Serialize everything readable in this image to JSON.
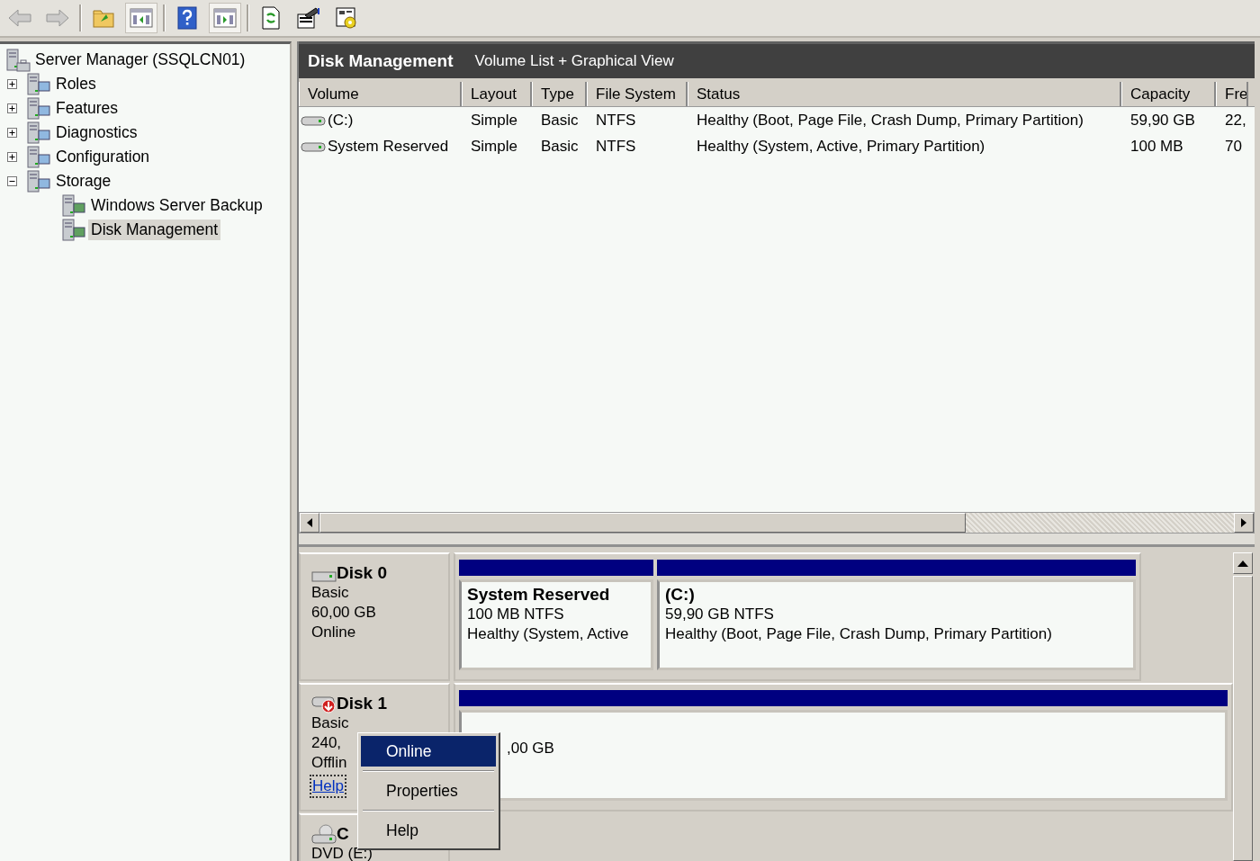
{
  "toolbar": [
    {
      "kind": "back",
      "disabled": true,
      "pressed": false
    },
    {
      "kind": "forward",
      "disabled": true,
      "pressed": false
    },
    {
      "kind": "up",
      "disabled": false,
      "pressed": false
    },
    {
      "kind": "tree-pane",
      "disabled": false,
      "pressed": true
    },
    {
      "kind": "help",
      "disabled": false,
      "pressed": false
    },
    {
      "kind": "action-pane",
      "disabled": false,
      "pressed": true
    },
    {
      "kind": "refresh",
      "disabled": false,
      "pressed": false
    },
    {
      "kind": "properties",
      "disabled": false,
      "pressed": false
    },
    {
      "kind": "settings",
      "disabled": false,
      "pressed": false
    }
  ],
  "tree": {
    "label": "Server Manager (SSQLCN01)",
    "selected": false,
    "children": [
      {
        "label": "Roles",
        "expanded": false,
        "selected": false
      },
      {
        "label": "Features",
        "expanded": false,
        "selected": false
      },
      {
        "label": "Diagnostics",
        "expanded": false,
        "selected": false
      },
      {
        "label": "Configuration",
        "expanded": false,
        "selected": false
      },
      {
        "label": "Storage",
        "expanded": true,
        "selected": false,
        "children": [
          {
            "label": "Windows Server Backup",
            "selected": false
          },
          {
            "label": "Disk Management",
            "selected": true
          }
        ]
      }
    ]
  },
  "header": {
    "title": "Disk Management",
    "view": "Volume List + Graphical View"
  },
  "volume_table": {
    "columns": [
      "Volume",
      "Layout",
      "Type",
      "File System",
      "Status",
      "Capacity",
      "Fre"
    ],
    "rows": [
      [
        "(C:)",
        "Simple",
        "Basic",
        "NTFS",
        "Healthy (Boot, Page File, Crash Dump, Primary Partition)",
        "59,90 GB",
        "22,"
      ],
      [
        "System Reserved",
        "Simple",
        "Basic",
        "NTFS",
        "Healthy (System, Active, Primary Partition)",
        "100 MB",
        "70"
      ]
    ]
  },
  "disks": [
    {
      "kind": "online",
      "name": "Disk 0",
      "lines": [
        "Basic",
        "60,00 GB",
        "Online"
      ],
      "partitions": [
        {
          "title": "System Reserved",
          "lines": [
            "100 MB NTFS",
            "Healthy (System, Active"
          ]
        },
        {
          "title": "(C:)",
          "lines": [
            "59,90 GB NTFS",
            "Healthy (Boot, Page File, Crash Dump, Primary Partition)"
          ]
        }
      ]
    },
    {
      "kind": "offline",
      "name": "Disk 1",
      "lines": [
        "Basic",
        "240,",
        "Offlin"
      ],
      "link": "Help",
      "partitions": [
        {
          "lines": [
            ",00 GB"
          ]
        }
      ]
    },
    {
      "kind": "cdrom",
      "name": "C",
      "lines": [
        "DVD (E:)"
      ]
    }
  ],
  "context_menu": [
    {
      "label": "Online",
      "selected": true
    },
    {
      "label": "Properties",
      "selected": false
    },
    {
      "label": "Help",
      "selected": false
    }
  ]
}
